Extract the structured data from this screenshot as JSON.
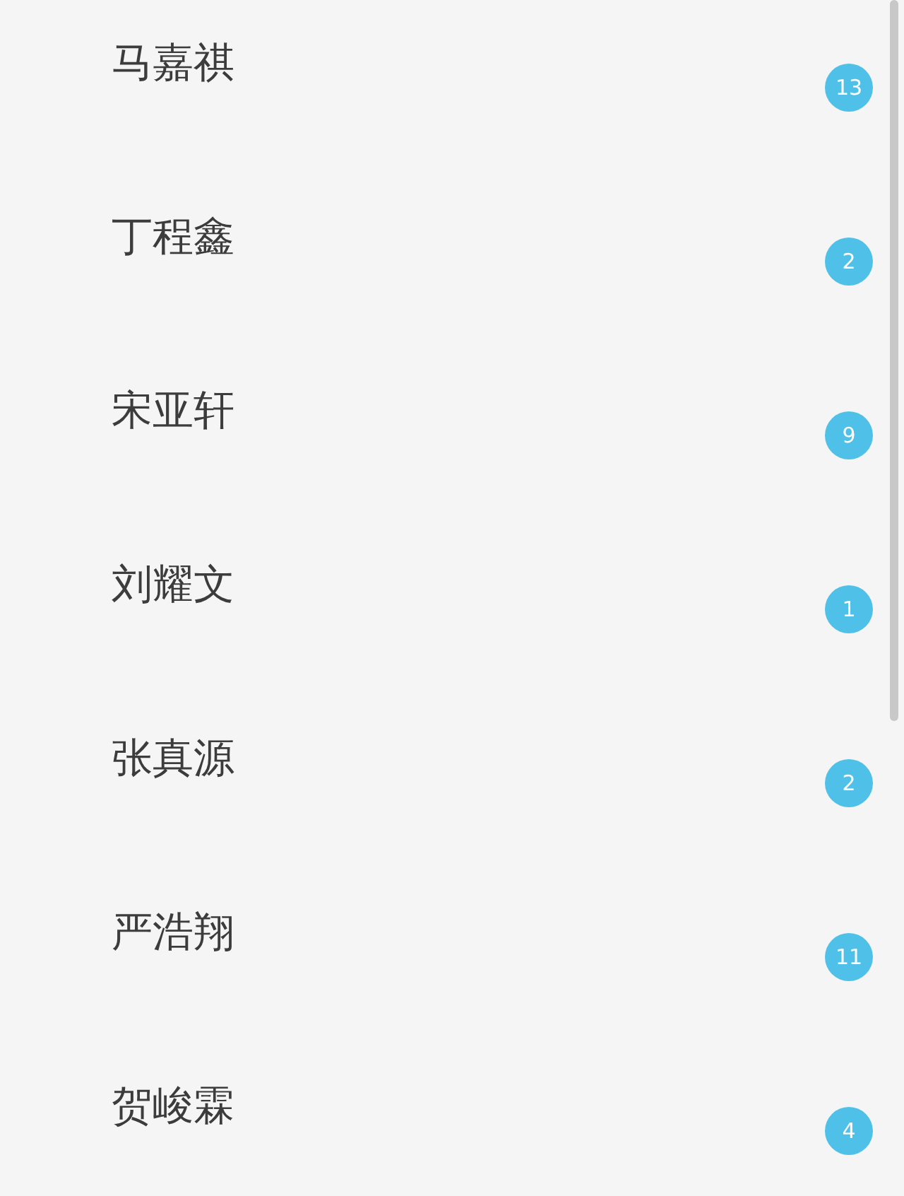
{
  "contacts": [
    {
      "name": "马嘉祺",
      "count": "13"
    },
    {
      "name": "丁程鑫",
      "count": "2"
    },
    {
      "name": "宋亚轩",
      "count": "9"
    },
    {
      "name": "刘耀文",
      "count": "1"
    },
    {
      "name": "张真源",
      "count": "2"
    },
    {
      "name": "严浩翔",
      "count": "11"
    },
    {
      "name": "贺峻霖",
      "count": "4"
    }
  ]
}
